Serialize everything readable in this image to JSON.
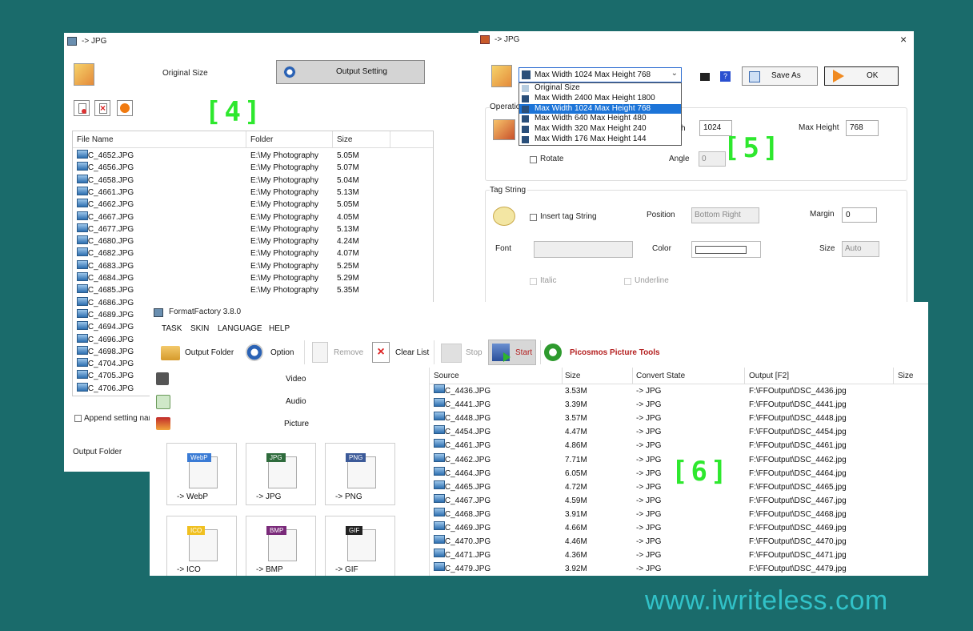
{
  "watermark": "www.iwriteless.com",
  "callouts": {
    "c4": "[4]",
    "c5": "[5]",
    "c6": "[6]"
  },
  "win4": {
    "title": "-> JPG",
    "original_size": "Original Size",
    "output_setting": "Output Setting",
    "columns": [
      "File Name",
      "Folder",
      "Size"
    ],
    "rows": [
      [
        "DSC_4652.JPG",
        "E:\\My Photography",
        "5.05M"
      ],
      [
        "DSC_4656.JPG",
        "E:\\My Photography",
        "5.07M"
      ],
      [
        "DSC_4658.JPG",
        "E:\\My Photography",
        "5.04M"
      ],
      [
        "DSC_4661.JPG",
        "E:\\My Photography",
        "5.13M"
      ],
      [
        "DSC_4662.JPG",
        "E:\\My Photography",
        "5.05M"
      ],
      [
        "DSC_4667.JPG",
        "E:\\My Photography",
        "4.05M"
      ],
      [
        "DSC_4677.JPG",
        "E:\\My Photography",
        "5.13M"
      ],
      [
        "DSC_4680.JPG",
        "E:\\My Photography",
        "4.24M"
      ],
      [
        "DSC_4682.JPG",
        "E:\\My Photography",
        "4.07M"
      ],
      [
        "DSC_4683.JPG",
        "E:\\My Photography",
        "5.25M"
      ],
      [
        "DSC_4684.JPG",
        "E:\\My Photography",
        "5.29M"
      ],
      [
        "DSC_4685.JPG",
        "E:\\My Photography",
        "5.35M"
      ],
      [
        "DSC_4686.JPG",
        "",
        ""
      ],
      [
        "DSC_4689.JPG",
        "",
        ""
      ],
      [
        "DSC_4694.JPG",
        "",
        ""
      ],
      [
        "DSC_4696.JPG",
        "",
        ""
      ],
      [
        "DSC_4698.JPG",
        "",
        ""
      ],
      [
        "DSC_4704.JPG",
        "",
        ""
      ],
      [
        "DSC_4705.JPG",
        "",
        ""
      ],
      [
        "DSC_4706.JPG",
        "",
        ""
      ]
    ],
    "append_setting": "Append setting nan",
    "output_folder": "Output Folder"
  },
  "win5": {
    "title": "-> JPG",
    "close": "×",
    "preset_selected": "Max Width 1024 Max Height 768",
    "preset_options": [
      "Original Size",
      "Max Width 2400 Max Height 1800",
      "Max Width 1024 Max Height 768",
      "Max Width 640 Max Height 480",
      "Max Width 320 Max Height 240",
      "Max Width 176 Max Height 144"
    ],
    "selected_index": 2,
    "save_as": "Save As",
    "ok": "OK",
    "operation_group": "Operatio",
    "width_label": "h",
    "width_value": "1024",
    "max_height_label": "Max Height",
    "max_height_value": "768",
    "rotate_label": "Rotate",
    "angle_label": "Angle",
    "angle_value": "0",
    "tag_group": "Tag String",
    "insert_tag": "Insert tag String",
    "position_label": "Position",
    "position_value": "Bottom Right",
    "margin_label": "Margin",
    "margin_value": "0",
    "font_label": "Font",
    "color_label": "Color",
    "size_label": "Size",
    "size_value": "Auto",
    "italic": "Italic",
    "underline": "Underline"
  },
  "win6": {
    "title": "FormatFactory 3.8.0",
    "menu": [
      "TASK",
      "SKIN",
      "LANGUAGE",
      "HELP"
    ],
    "toolbar": {
      "output_folder": "Output Folder",
      "option": "Option",
      "remove": "Remove",
      "clear_list": "Clear List",
      "stop": "Stop",
      "start": "Start",
      "picosmos": "Picosmos Picture Tools"
    },
    "categories": [
      "Video",
      "Audio",
      "Picture"
    ],
    "tiles": [
      {
        "badge": "WebP",
        "caption": "-> WebP",
        "color": "#3a7bd5"
      },
      {
        "badge": "JPG",
        "caption": "-> JPG",
        "color": "#2e6b3c"
      },
      {
        "badge": "PNG",
        "caption": "-> PNG",
        "color": "#3c5a99"
      },
      {
        "badge": "ICO",
        "caption": "-> ICO",
        "color": "#f0c020"
      },
      {
        "badge": "BMP",
        "caption": "-> BMP",
        "color": "#7a2a7a"
      },
      {
        "badge": "GIF",
        "caption": "-> GIF",
        "color": "#222222"
      }
    ],
    "columns": [
      "Source",
      "Size",
      "Convert State",
      "Output [F2]",
      "Size"
    ],
    "rows": [
      [
        "DSC_4436.JPG",
        "3.53M",
        "-> JPG",
        "F:\\FFOutput\\DSC_4436.jpg"
      ],
      [
        "DSC_4441.JPG",
        "3.39M",
        "-> JPG",
        "F:\\FFOutput\\DSC_4441.jpg"
      ],
      [
        "DSC_4448.JPG",
        "3.57M",
        "-> JPG",
        "F:\\FFOutput\\DSC_4448.jpg"
      ],
      [
        "DSC_4454.JPG",
        "4.47M",
        "-> JPG",
        "F:\\FFOutput\\DSC_4454.jpg"
      ],
      [
        "DSC_4461.JPG",
        "4.86M",
        "-> JPG",
        "F:\\FFOutput\\DSC_4461.jpg"
      ],
      [
        "DSC_4462.JPG",
        "7.71M",
        "-> JPG",
        "F:\\FFOutput\\DSC_4462.jpg"
      ],
      [
        "DSC_4464.JPG",
        "6.05M",
        "-> JPG",
        "F:\\FFOutput\\DSC_4464.jpg"
      ],
      [
        "DSC_4465.JPG",
        "4.72M",
        "-> JPG",
        "F:\\FFOutput\\DSC_4465.jpg"
      ],
      [
        "DSC_4467.JPG",
        "4.59M",
        "-> JPG",
        "F:\\FFOutput\\DSC_4467.jpg"
      ],
      [
        "DSC_4468.JPG",
        "3.91M",
        "-> JPG",
        "F:\\FFOutput\\DSC_4468.jpg"
      ],
      [
        "DSC_4469.JPG",
        "4.66M",
        "-> JPG",
        "F:\\FFOutput\\DSC_4469.jpg"
      ],
      [
        "DSC_4470.JPG",
        "4.46M",
        "-> JPG",
        "F:\\FFOutput\\DSC_4470.jpg"
      ],
      [
        "DSC_4471.JPG",
        "4.36M",
        "-> JPG",
        "F:\\FFOutput\\DSC_4471.jpg"
      ],
      [
        "DSC_4479.JPG",
        "3.92M",
        "-> JPG",
        "F:\\FFOutput\\DSC_4479.jpg"
      ]
    ]
  }
}
